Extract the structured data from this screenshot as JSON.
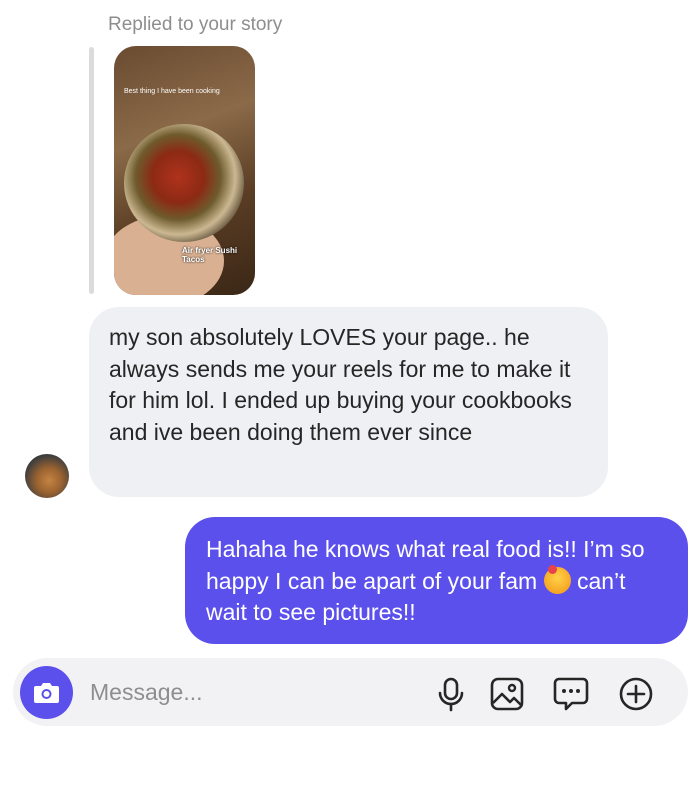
{
  "reply_context": {
    "label": "Replied to your story",
    "story_caption_top": "Best thing I have been cooking",
    "story_caption_bottom": "Air fryer Sushi Tacos"
  },
  "messages": [
    {
      "direction": "incoming",
      "text": "my son absolutely LOVES your page.. he always sends me your reels for me to make it for him lol. I ended up buying your cookbooks and ive been doing them ever since"
    },
    {
      "direction": "outgoing",
      "text": "Hahaha he knows what real food is!! I’m so happy I can be apart of your fam",
      "emoji": "smiling-face-with-hearts",
      "text_after_emoji": "can’t wait to see pictures!!"
    }
  ],
  "composer": {
    "placeholder": "Message..."
  },
  "colors": {
    "accent": "#5c50ec",
    "incoming_bubble": "#eff0f4",
    "muted_text": "#8e8e8e"
  }
}
